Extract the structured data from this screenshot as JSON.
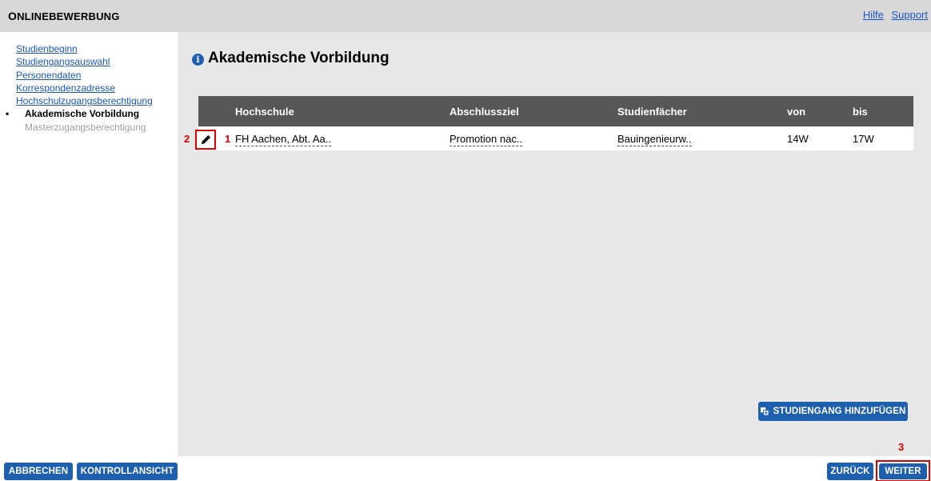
{
  "header": {
    "title_first": "O",
    "title_rest": "nlinebewerbung",
    "links": [
      "Hilfe",
      "Support"
    ]
  },
  "sidebar": {
    "items": [
      {
        "label": "Studienbeginn"
      },
      {
        "label": "Studiengangsauswahl"
      },
      {
        "label": "Personendaten"
      },
      {
        "label": "Korrespondenzadresse"
      },
      {
        "label": "Hochschulzugangsberechtigung"
      },
      {
        "label": "Akademische Vorbildung"
      },
      {
        "label": "Masterzugangsberechtigung"
      }
    ]
  },
  "main": {
    "title": "Akademische Vorbildung",
    "table": {
      "headers": [
        "Hochschule",
        "Abschlussziel",
        "Studienfächer",
        "von",
        "bis"
      ],
      "rows": [
        {
          "number": "1",
          "hochschule": "FH Aachen, Abt. Aa..",
          "abschlussziel": "Promotion nac..",
          "studienfaecher": "Bauingenieurw..",
          "von": "14W",
          "bis": "17W"
        }
      ]
    },
    "add_button": "Studiengang hinzufügen"
  },
  "annotations": {
    "edit": "2",
    "next": "3"
  },
  "footer": {
    "cancel": "Abbrechen",
    "review": "Kontrollansicht",
    "back": "Zurück",
    "next": "Weiter"
  },
  "colors": {
    "accent": "#1e5fae",
    "header_bg": "#d8d8d8",
    "table_header": "#575757",
    "annotation": "#e00000"
  }
}
